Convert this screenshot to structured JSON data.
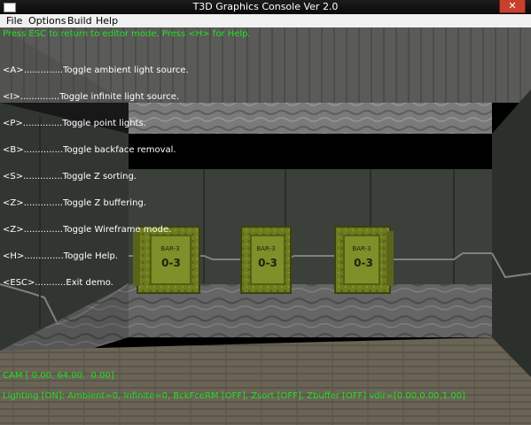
{
  "window": {
    "title": "T3D Graphics Console Ver 2.0",
    "close_glyph": "✕"
  },
  "menu": {
    "items": [
      "File",
      "Options",
      "Build",
      "Help"
    ]
  },
  "hud": {
    "top_message": "Press ESC to return to editor mode. Press <H> for Help.",
    "help_lines": [
      "<A>..............Toggle ambient light source.",
      "<I>..............Toggle infinite light source.",
      "<P>..............Toggle point lights.",
      "<B>..............Toggle backface removal.",
      "<S>..............Toggle Z sorting.",
      "<Z>..............Toggle Z buffering.",
      "<Z>..............Toggle Wireframe mode.",
      "<H>..............Toggle Help.",
      "<ESC>...........Exit demo."
    ],
    "cam": "CAM [ 0.00, 64.00,  0.00]",
    "status": "Lighting [ON]: Ambient=0, Infinite=0, BckFceRM [OFF], Zsort [OFF], Zbuffer [OFF] vdir=[0.00,0.00,1.00]"
  },
  "crate_labels": {
    "line1": "BAR-3",
    "line2": "0-3"
  },
  "colors": {
    "hud_green": "#22e022",
    "hud_white": "#ffffff",
    "crate_olive": "#6b7a1e"
  }
}
